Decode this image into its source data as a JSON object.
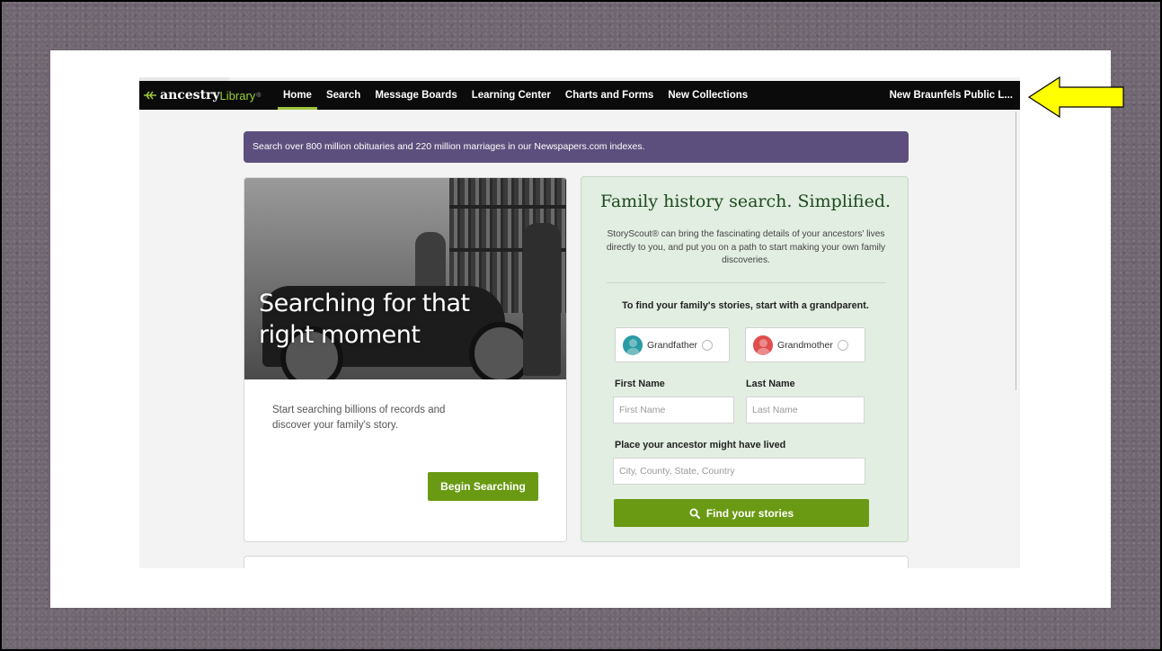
{
  "nav": {
    "logo_main": "ancestry",
    "logo_sub": "Library",
    "logo_tm": "®",
    "items": [
      "Home",
      "Search",
      "Message Boards",
      "Learning Center",
      "Charts and Forms",
      "New Collections"
    ],
    "active_item": "Home",
    "library_name": "New Braunfels Public L..."
  },
  "promo": {
    "text": "Search over 800 million obituaries and 220 million marriages in our Newspapers.com indexes."
  },
  "left_card": {
    "hero_title": "Searching for that right moment",
    "description": "Start searching billions of records and discover your family's story.",
    "button_label": "Begin Searching"
  },
  "right_card": {
    "title": "Family history search. Simplified.",
    "description": "StoryScout® can bring the fascinating details of your ancestors' lives directly to you, and put you on a path to start making your own family discoveries.",
    "prompt": "To find your family's stories, start with a grandparent.",
    "grandfather_label": "Grandfather",
    "grandmother_label": "Grandmother",
    "first_name_label": "First Name",
    "first_name_placeholder": "First Name",
    "last_name_label": "Last Name",
    "last_name_placeholder": "Last Name",
    "place_label": "Place your ancestor might have lived",
    "place_placeholder": "City, County, State, Country",
    "find_button_label": "Find your stories"
  },
  "colors": {
    "nav_bg": "#0b0b0b",
    "accent_green": "#6a9a13",
    "promo_purple": "#5d4f7d",
    "search_panel_bg": "#e2eee2",
    "arrow_yellow": "#ffff00"
  },
  "icons": [
    "leaf-logo-icon",
    "grandfather-avatar-icon",
    "grandmother-avatar-icon",
    "search-icon",
    "arrow-left-icon"
  ]
}
